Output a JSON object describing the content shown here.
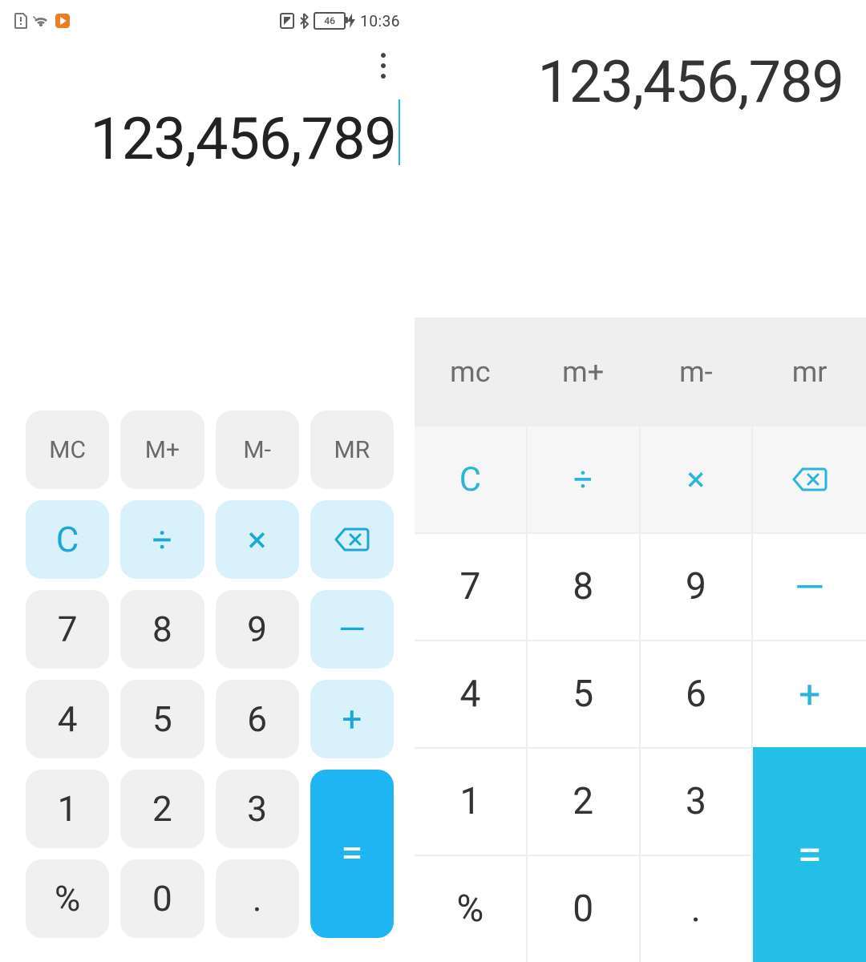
{
  "status": {
    "battery": "46",
    "time": "10:36"
  },
  "left": {
    "display": "123,456,789",
    "keys": {
      "mc": "MC",
      "mplus": "M+",
      "mminus": "M-",
      "mr": "MR",
      "clear": "C",
      "div": "÷",
      "mul": "×",
      "k7": "7",
      "k8": "8",
      "k9": "9",
      "minus": "—",
      "k4": "4",
      "k5": "5",
      "k6": "6",
      "plus": "+",
      "k1": "1",
      "k2": "2",
      "k3": "3",
      "eq": "=",
      "pct": "%",
      "k0": "0",
      "dot": "."
    }
  },
  "right": {
    "display": "123,456,789",
    "keys": {
      "mc": "mc",
      "mplus": "m+",
      "mminus": "m-",
      "mr": "mr",
      "clear": "C",
      "div": "÷",
      "mul": "×",
      "k7": "7",
      "k8": "8",
      "k9": "9",
      "minus": "—",
      "k4": "4",
      "k5": "5",
      "k6": "6",
      "plus": "+",
      "k1": "1",
      "k2": "2",
      "k3": "3",
      "eq": "=",
      "pct": "%",
      "k0": "0",
      "dot": "."
    }
  }
}
